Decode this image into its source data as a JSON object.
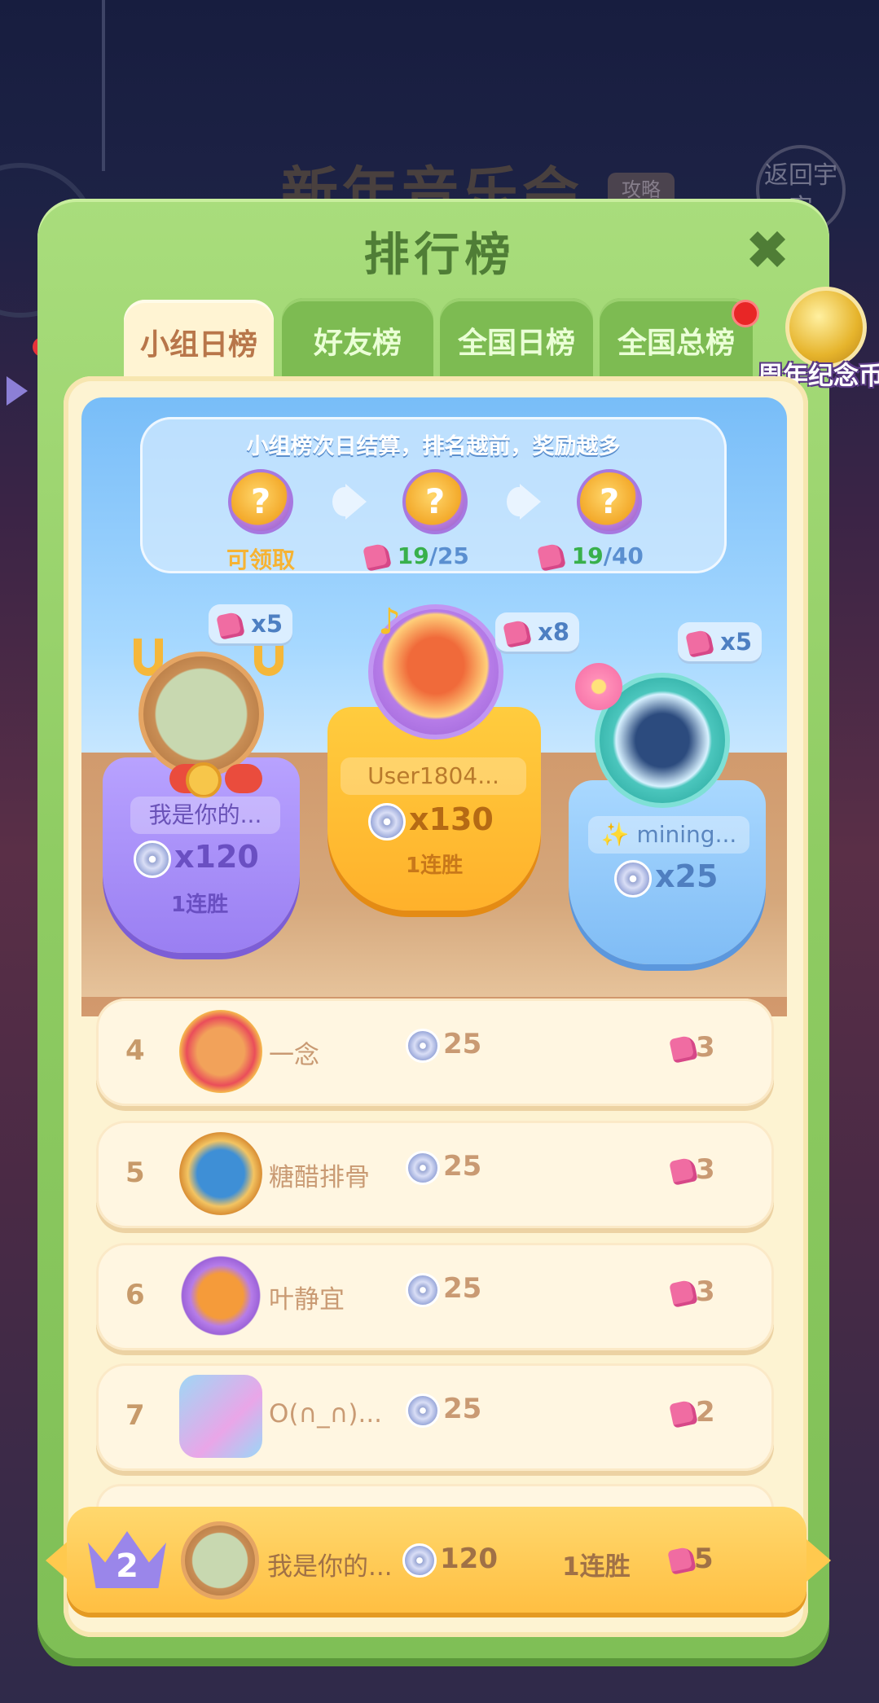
{
  "background": {
    "event_title": "新年音乐会",
    "guide_tag": "攻略",
    "back_button": "返回宇宙"
  },
  "panel": {
    "title": "排行榜",
    "close_icon": "close-icon"
  },
  "tabs": [
    {
      "label": "小组日榜",
      "active": true
    },
    {
      "label": "好友榜",
      "active": false
    },
    {
      "label": "全国日榜",
      "active": false
    },
    {
      "label": "全国总榜",
      "active": false
    }
  ],
  "coin_badge": {
    "label": "周年纪念币",
    "has_notification": true
  },
  "info": {
    "text": "小组榜次日结算，排名越前，奖励越多",
    "rewards": [
      {
        "label": "可领取"
      },
      {
        "current": "19",
        "total": "/25"
      },
      {
        "current": "19",
        "total": "/40"
      }
    ]
  },
  "podium": [
    {
      "rank": 2,
      "name": "我是你的...",
      "score": "x120",
      "streak": "1连胜",
      "hearts": "x5"
    },
    {
      "rank": 1,
      "name": "User1804...",
      "score": "x130",
      "streak": "1连胜",
      "hearts": "x8"
    },
    {
      "rank": 3,
      "name": "✨ mining...",
      "score": "x25",
      "streak": "",
      "hearts": "x5"
    }
  ],
  "rows": [
    {
      "rank": "4",
      "name": "一念",
      "score": "25",
      "hearts": "3"
    },
    {
      "rank": "5",
      "name": "糖醋排骨",
      "score": "25",
      "hearts": "3"
    },
    {
      "rank": "6",
      "name": "叶静宜",
      "score": "25",
      "hearts": "3"
    },
    {
      "rank": "7",
      "name": "O(∩_∩)...",
      "score": "25",
      "hearts": "2"
    }
  ],
  "me": {
    "rank": "2",
    "name": "我是你的...",
    "score": "120",
    "streak": "1连胜",
    "hearts": "5"
  },
  "colors": {
    "panel": "#8fcc63",
    "rank1": "#ffbf3a",
    "rank2": "#9f86f5",
    "rank3": "#86c4f8",
    "heart": "#f06ca2",
    "text_brown": "#c99a73"
  }
}
